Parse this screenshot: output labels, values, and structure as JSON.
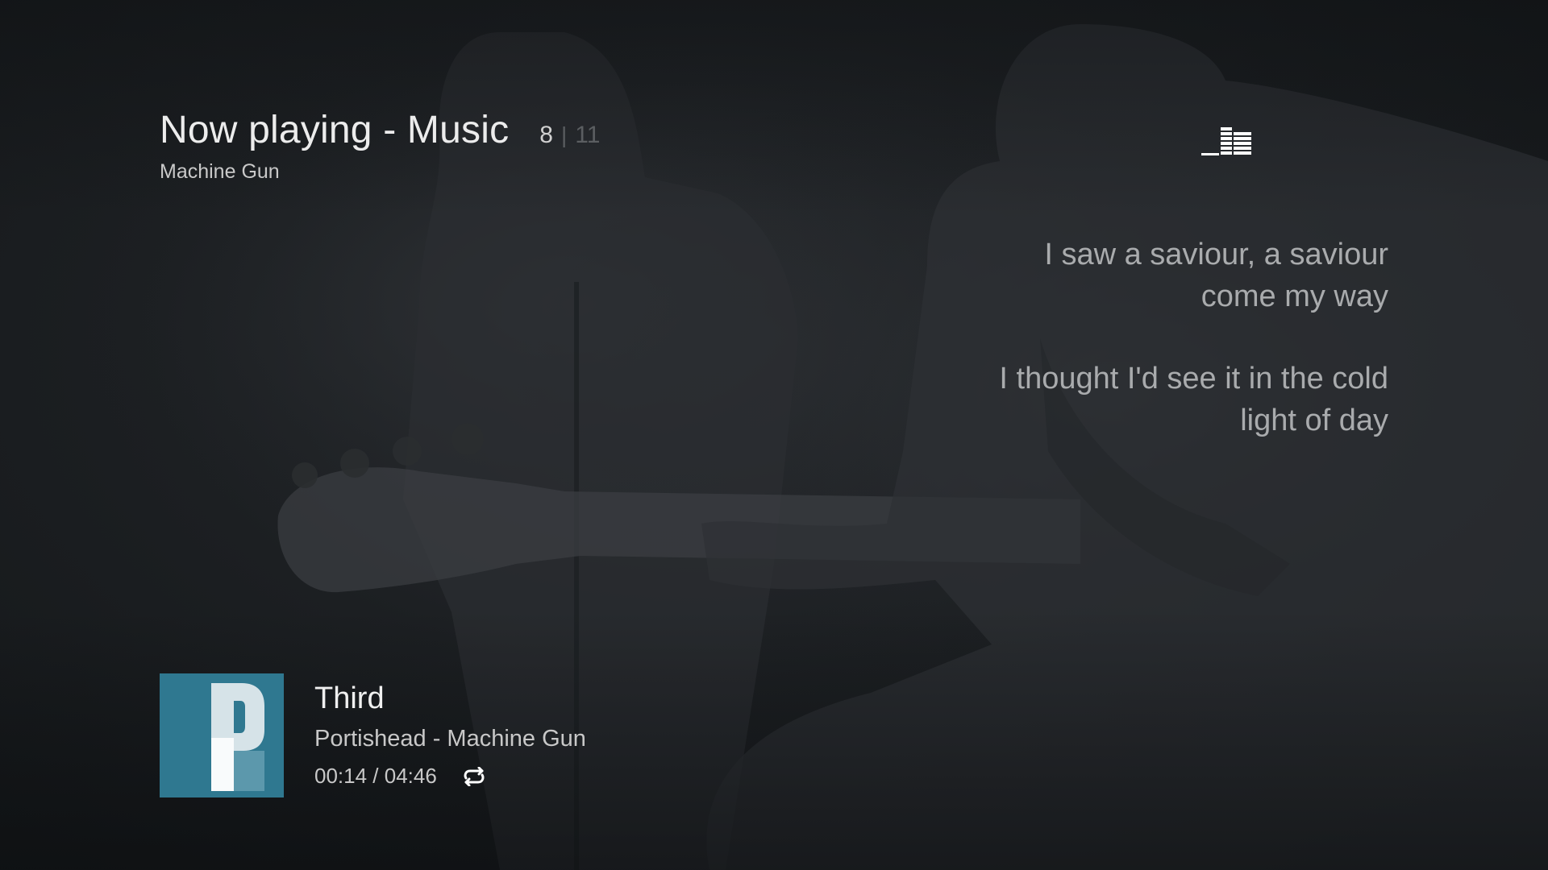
{
  "header": {
    "title": "Now playing - Music",
    "subtitle": "Machine Gun",
    "counter_current": "8",
    "counter_separator": "|",
    "counter_total": "11"
  },
  "logo": {
    "icon": "deezer-equalizer-icon"
  },
  "lyrics": {
    "lines": [
      "I saw a saviour, a saviour",
      "come my way",
      "I thought I'd see it in the cold",
      "light of day"
    ]
  },
  "player": {
    "album": "Third",
    "artist_track": "Portishead - Machine Gun",
    "elapsed": "00:14",
    "time_separator": "/",
    "duration": "04:46",
    "time_display": "00:14 / 04:46",
    "repeat_icon": "repeat-icon",
    "album_art_icon": "album-art-letter-p",
    "album_art_color": "#2f7890"
  },
  "colors": {
    "background": "#16191c",
    "text_primary": "#ececec",
    "text_secondary": "#c8c8c8",
    "lyrics": "#a9abad",
    "counter_dim": "#5b5e61"
  }
}
